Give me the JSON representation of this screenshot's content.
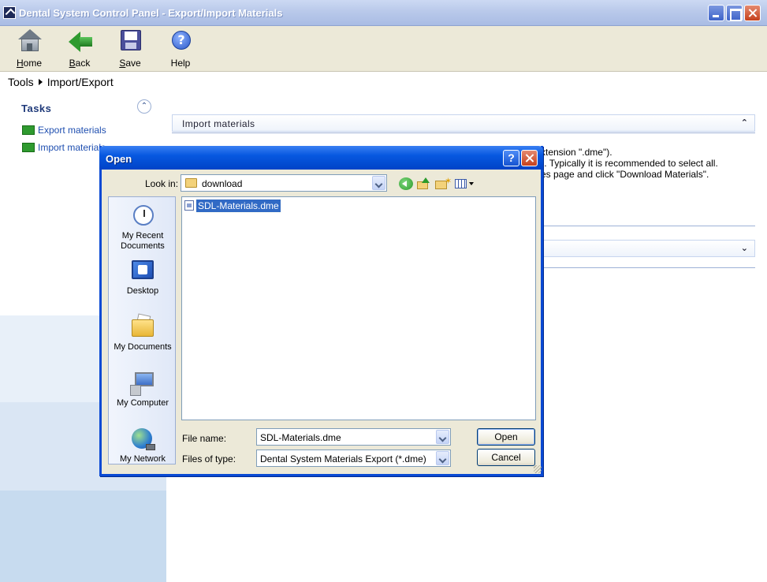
{
  "window": {
    "title": "Dental System Control Panel - Export/Import Materials"
  },
  "toolbar": {
    "home": {
      "mnemonic": "H",
      "rest": "ome"
    },
    "back": {
      "mnemonic": "B",
      "rest": "ack"
    },
    "save": {
      "mnemonic": "S",
      "rest": "ave"
    },
    "help": {
      "mnemonic": "",
      "rest": "Help"
    }
  },
  "breadcrumb": {
    "root": "Tools",
    "current": "Import/Export"
  },
  "tasks": {
    "title": "Tasks",
    "items": [
      {
        "label": "Export materials"
      },
      {
        "label": "Import materials"
      }
    ]
  },
  "main": {
    "section_title": "Import materials",
    "desc_lines": [
      "xtension \".dme\").",
      "\". Typically it is recommended to select all.",
      "es page and click \"Download Materials\"."
    ]
  },
  "dialog": {
    "title": "Open",
    "help_label": "?",
    "look_in_label": "Look in:",
    "look_in_value": "download",
    "places": [
      {
        "label": "My Recent Documents",
        "icon": "recent-documents-icon"
      },
      {
        "label": "Desktop",
        "icon": "desktop-icon"
      },
      {
        "label": "My Documents",
        "icon": "my-documents-icon"
      },
      {
        "label": "My Computer",
        "icon": "my-computer-icon"
      },
      {
        "label": "My Network",
        "icon": "my-network-icon"
      }
    ],
    "files": [
      {
        "name": "SDL-Materials.dme",
        "selected": true
      }
    ],
    "file_name_label": "File name:",
    "file_name_value": "SDL-Materials.dme",
    "file_type_label": "Files of type:",
    "file_type_value": "Dental System Materials Export (*.dme)",
    "open_label": "Open",
    "cancel_label": "Cancel"
  },
  "colors": {
    "dialog_title": "#0758e0",
    "selection": "#316ac5",
    "task_link": "#1f4fb0"
  }
}
